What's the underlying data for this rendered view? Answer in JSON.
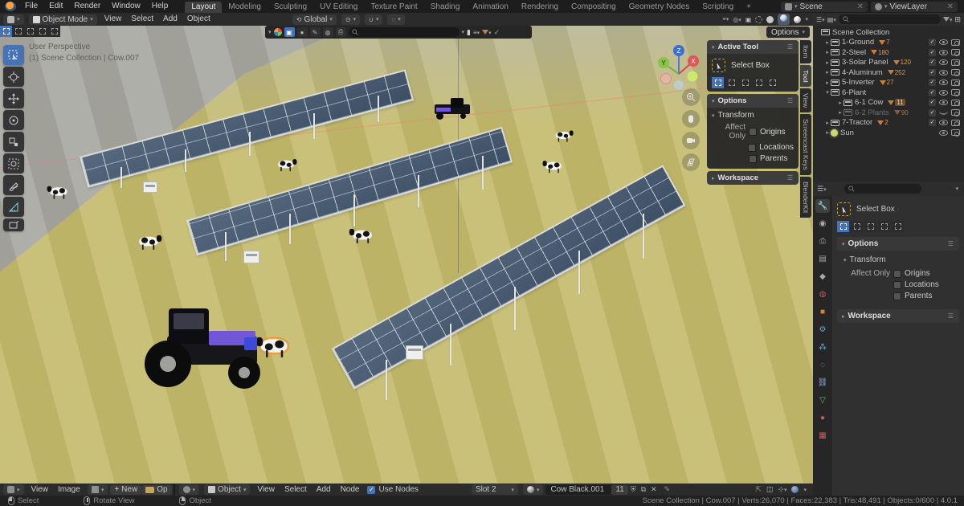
{
  "colors": {
    "accent": "#4772b3",
    "selection_orange": "#ff8c1a",
    "badge_orange": "#cf8b4a",
    "header_bg": "#2b2b2b",
    "ground": "#c3ba6c"
  },
  "topbar": {
    "menus": [
      "File",
      "Edit",
      "Render",
      "Window",
      "Help"
    ],
    "workspaces": [
      "Layout",
      "Modeling",
      "Sculpting",
      "UV Editing",
      "Texture Paint",
      "Shading",
      "Animation",
      "Rendering",
      "Compositing",
      "Geometry Nodes",
      "Scripting"
    ],
    "add_workspace": "+",
    "scene": "Scene",
    "viewlayer": "ViewLayer"
  },
  "viewport_header": {
    "mode": "Object Mode",
    "menus": [
      "View",
      "Select",
      "Add",
      "Object"
    ],
    "orientation": "Global",
    "options": "Options"
  },
  "viewport_overlay": {
    "line1": "User Perspective",
    "line2": "(1) Scene Collection | Cow.007"
  },
  "npanel_tabs": [
    "Item",
    "Tool",
    "View",
    "Screencast Keys",
    "BlenderKit"
  ],
  "tool_panel": {
    "header": "Active Tool",
    "tool": "Select Box",
    "options": "Options",
    "transform": "Transform",
    "affect_only": "Affect Only",
    "origins": "Origins",
    "locations": "Locations",
    "parents": "Parents",
    "workspace": "Workspace"
  },
  "gizmo_axes": {
    "x": "X",
    "y": "Y",
    "z": "Z"
  },
  "outliner": {
    "rows": [
      {
        "label": "Scene Collection",
        "count": ""
      },
      {
        "label": "1-Ground",
        "count": "7"
      },
      {
        "label": "2-Steel",
        "count": "180"
      },
      {
        "label": "3-Solar Panel",
        "count": "120"
      },
      {
        "label": "4-Aluminum",
        "count": "252"
      },
      {
        "label": "5-Inverter",
        "count": "27"
      },
      {
        "label": "6-Plant",
        "count": ""
      },
      {
        "label": "6-1 Cow",
        "count": "11"
      },
      {
        "label": "6-2 Plants",
        "count": "90"
      },
      {
        "label": "7-Tractor",
        "count": "2"
      },
      {
        "label": "Sun",
        "count": ""
      }
    ]
  },
  "bottom": {
    "image_menus": [
      "View",
      "Image"
    ],
    "new": "New",
    "open": "Op",
    "shader_context": "Object",
    "shader_menus": [
      "View",
      "Select",
      "Add",
      "Node"
    ],
    "use_nodes": "Use Nodes",
    "slot": "Slot 2",
    "material": "Cow Black.001",
    "users": "11"
  },
  "statusbar": {
    "hints": [
      "Select",
      "Rotate View",
      "Object"
    ],
    "stats": "Scene Collection | Cow.007 | Verts:26,070 | Faces:22,383 | Tris:48,491 | Objects:0/600 | 4.0.1"
  }
}
